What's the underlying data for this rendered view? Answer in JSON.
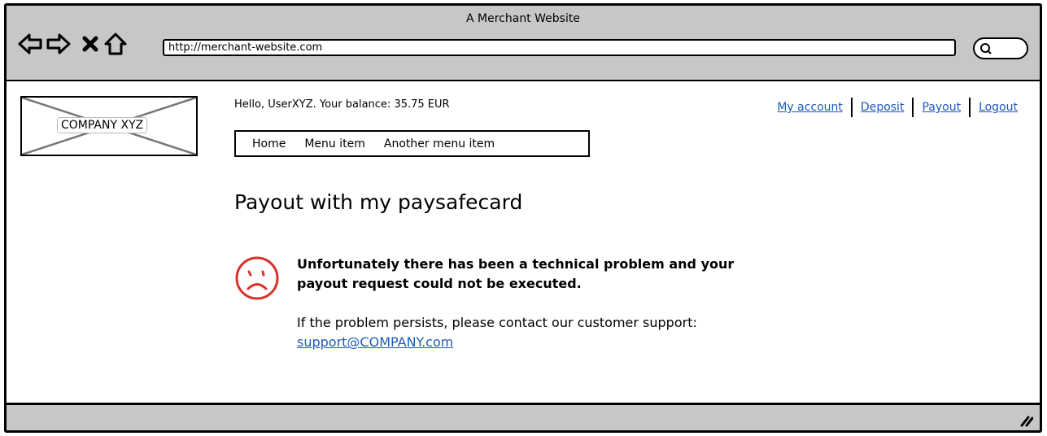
{
  "browser": {
    "window_title": "A Merchant Website",
    "url": "http://merchant-website.com",
    "nav_icons": [
      "back-arrow-icon",
      "forward-arrow-icon",
      "stop-icon",
      "home-icon"
    ],
    "search_icon": "search-icon"
  },
  "header": {
    "logo_text": "COMPANY XYZ",
    "greeting": "Hello, UserXYZ. Your balance: 35.75 EUR",
    "account_links": [
      "My account",
      "Deposit",
      "Payout",
      "Logout"
    ],
    "menu": [
      "Home",
      "Menu item",
      "Another menu item"
    ]
  },
  "main": {
    "heading": "Payout with my paysafecard",
    "error_icon": "sad-face-icon",
    "error_message": "Unfortunately there has been a technical problem and your payout request could not be executed.",
    "support_text": "If the problem persists, please contact our customer support:",
    "support_email": "support@COMPANY.com"
  },
  "colors": {
    "chrome_background": "#c7c7c7",
    "link": "#1d5ab8",
    "error_icon": "#d9302a"
  }
}
